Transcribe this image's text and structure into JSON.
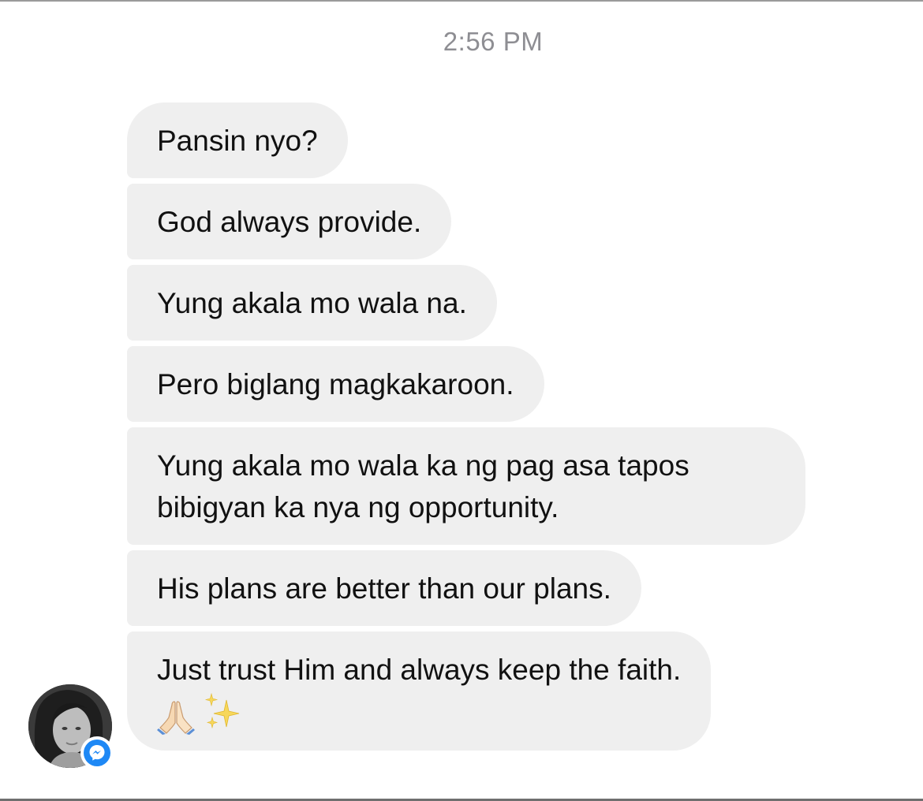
{
  "thread": {
    "timestamp": "2:56 PM",
    "messages": [
      {
        "text": "Pansin nyo?"
      },
      {
        "text": "God always provide."
      },
      {
        "text": "Yung akala mo wala na."
      },
      {
        "text": "Pero biglang magkakaroon."
      },
      {
        "text": "Yung akala mo wala ka ng pag asa tapos bibigyan ka nya ng opportunity."
      },
      {
        "text": "His plans are better than our plans."
      },
      {
        "text": "Just trust Him and always keep the faith.",
        "emojis": [
          "folded-hands-emoji",
          "sparkles-emoji"
        ]
      }
    ]
  },
  "sender": {
    "avatar_icon": "user-avatar",
    "badge_icon": "messenger-icon",
    "badge_color": "#1e88f5"
  },
  "colors": {
    "bubble": "#efefef",
    "timestamp": "#8e8e93"
  }
}
